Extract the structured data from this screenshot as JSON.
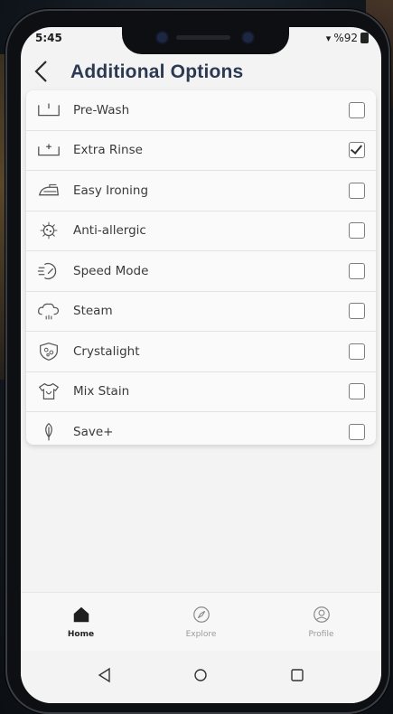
{
  "status_bar": {
    "time": "5:45",
    "battery": "%92"
  },
  "header": {
    "title": "Additional Options"
  },
  "options": [
    {
      "label": "Pre-Wash",
      "icon": "pre-wash-icon",
      "checked": false
    },
    {
      "label": "Extra Rinse",
      "icon": "extra-rinse-icon",
      "checked": true
    },
    {
      "label": "Easy Ironing",
      "icon": "iron-icon",
      "checked": false
    },
    {
      "label": "Anti-allergic",
      "icon": "anti-allergic-icon",
      "checked": false
    },
    {
      "label": "Speed Mode",
      "icon": "speed-mode-icon",
      "checked": false
    },
    {
      "label": "Steam",
      "icon": "steam-icon",
      "checked": false
    },
    {
      "label": "Crystalight",
      "icon": "crystalight-icon",
      "checked": false
    },
    {
      "label": "Mix Stain",
      "icon": "mix-stain-icon",
      "checked": false
    },
    {
      "label": "Save+",
      "icon": "leaf-icon",
      "checked": false
    }
  ],
  "tabs": [
    {
      "label": "Home",
      "icon": "home-icon",
      "active": true
    },
    {
      "label": "Explore",
      "icon": "compass-icon",
      "active": false
    },
    {
      "label": "Profile",
      "icon": "profile-icon",
      "active": false
    }
  ],
  "colors": {
    "title": "#2b3a52",
    "background": "#f3f3f3"
  }
}
